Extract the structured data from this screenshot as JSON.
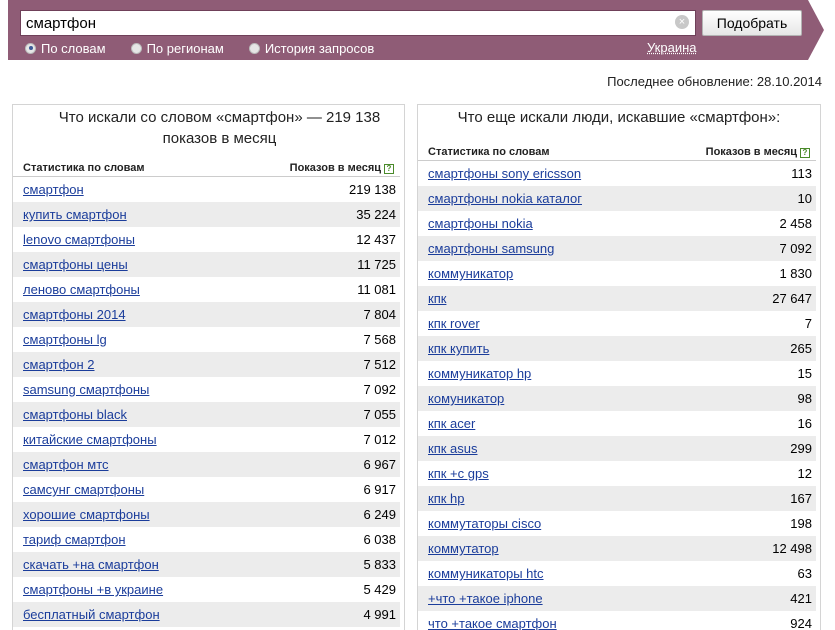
{
  "search": {
    "query": "смартфон",
    "submit_label": "Подобрать",
    "modes": [
      {
        "label": "По словам",
        "checked": true
      },
      {
        "label": "По регионам",
        "checked": false
      },
      {
        "label": "История запросов",
        "checked": false
      }
    ],
    "region": "Украина"
  },
  "last_update": "Последнее обновление: 28.10.2014",
  "left_panel": {
    "title": "Что искали со словом «смартфон» — 219 138 показов в месяц",
    "col_phrase": "Статистика по словам",
    "col_count": "Показов в месяц",
    "help": "?",
    "rows": [
      {
        "phrase": "смартфон",
        "count": "219 138"
      },
      {
        "phrase": "купить смартфон",
        "count": "35 224"
      },
      {
        "phrase": "lenovo смартфоны",
        "count": "12 437"
      },
      {
        "phrase": "смартфоны цены",
        "count": "11 725"
      },
      {
        "phrase": "леново смартфоны",
        "count": "11 081"
      },
      {
        "phrase": "смартфоны 2014",
        "count": "7 804"
      },
      {
        "phrase": "смартфоны lg",
        "count": "7 568"
      },
      {
        "phrase": "смартфон 2",
        "count": "7 512"
      },
      {
        "phrase": "samsung смартфоны",
        "count": "7 092"
      },
      {
        "phrase": "смартфоны black",
        "count": "7 055"
      },
      {
        "phrase": "китайские смартфоны",
        "count": "7 012"
      },
      {
        "phrase": "смартфон мтс",
        "count": "6 967"
      },
      {
        "phrase": "самсунг смартфоны",
        "count": "6 917"
      },
      {
        "phrase": "хорошие смартфоны",
        "count": "6 249"
      },
      {
        "phrase": "тариф смартфон",
        "count": "6 038"
      },
      {
        "phrase": "скачать +на смартфон",
        "count": "5 833"
      },
      {
        "phrase": "смартфоны +в украине",
        "count": "5 429"
      },
      {
        "phrase": "бесплатный смартфон",
        "count": "4 991"
      }
    ]
  },
  "right_panel": {
    "title": "Что еще искали люди, искавшие «смартфон»:",
    "col_phrase": "Статистика по словам",
    "col_count": "Показов в месяц",
    "help": "?",
    "rows": [
      {
        "phrase": "смартфоны sony ericsson",
        "count": "113"
      },
      {
        "phrase": "смартфоны nokia каталог",
        "count": "10"
      },
      {
        "phrase": "смартфоны nokia",
        "count": "2 458"
      },
      {
        "phrase": "смартфоны samsung",
        "count": "7 092"
      },
      {
        "phrase": "коммуникатор",
        "count": "1 830"
      },
      {
        "phrase": "кпк",
        "count": "27 647"
      },
      {
        "phrase": "кпк rover",
        "count": "7"
      },
      {
        "phrase": "кпк купить",
        "count": "265"
      },
      {
        "phrase": "коммуникатор hp",
        "count": "15"
      },
      {
        "phrase": "комуникатор",
        "count": "98"
      },
      {
        "phrase": "кпк acer",
        "count": "16"
      },
      {
        "phrase": "кпк asus",
        "count": "299"
      },
      {
        "phrase": "кпк +с gps",
        "count": "12"
      },
      {
        "phrase": "кпк hp",
        "count": "167"
      },
      {
        "phrase": "коммутаторы cisco",
        "count": "198"
      },
      {
        "phrase": "коммутатор",
        "count": "12 498"
      },
      {
        "phrase": "коммуникаторы htc",
        "count": "63"
      },
      {
        "phrase": "+что +такое iphone",
        "count": "421"
      },
      {
        "phrase": "что +такое смартфон",
        "count": "924"
      }
    ]
  },
  "colors": {
    "topbar": "#8f5c76",
    "link": "#1b3d9b",
    "row_stripe": "#ececec"
  }
}
